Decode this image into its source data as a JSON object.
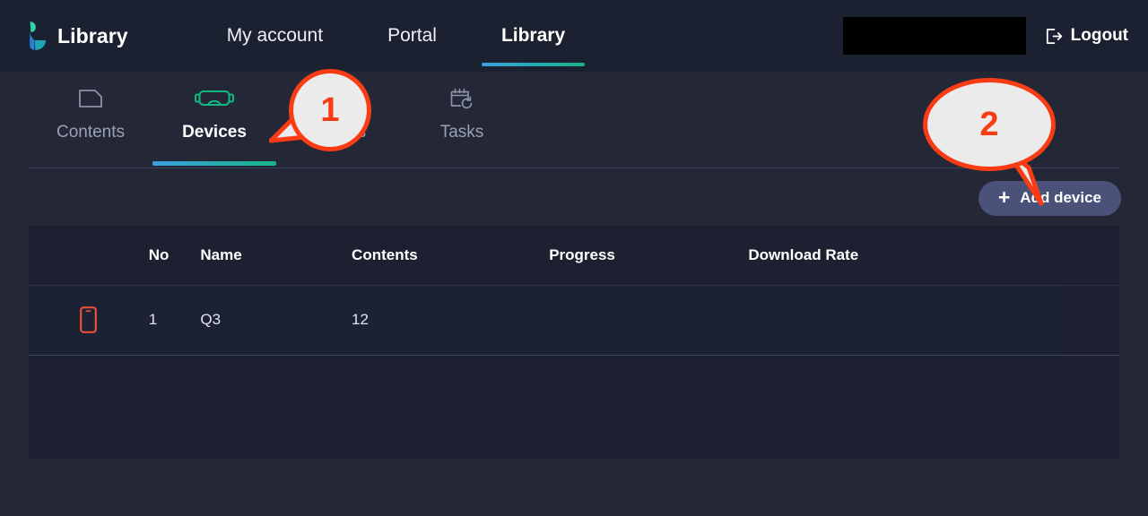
{
  "brand": {
    "name": "Library",
    "logo_icon": "library-logo-icon",
    "logo_color_top": "#2fd3a5",
    "logo_color_bottom": "#2b7fd4"
  },
  "topnav": {
    "items": [
      {
        "label": "My account",
        "active": false
      },
      {
        "label": "Portal",
        "active": false
      },
      {
        "label": "Library",
        "active": true
      }
    ],
    "active_underline_colors": [
      "#3b9fe0",
      "#18b488"
    ]
  },
  "topbar_right": {
    "redacted_field": "",
    "logout_label": "Logout",
    "logout_icon": "logout-icon"
  },
  "tabs": [
    {
      "label": "Contents",
      "icon": "folder-icon",
      "active": false
    },
    {
      "label": "Devices",
      "icon": "vr-headset-icon",
      "active": true
    },
    {
      "label": "Groups",
      "icon": "groups-icon",
      "active": false
    },
    {
      "label": "Tasks",
      "icon": "calendar-refresh-icon",
      "active": false
    }
  ],
  "actions": {
    "add_device_label": "Add device",
    "add_device_icon": "plus-icon",
    "add_device_color": "#4a5279"
  },
  "table": {
    "columns": [
      "",
      "No",
      "Name",
      "Contents",
      "Progress",
      "Download Rate"
    ],
    "rows": [
      {
        "device_icon": "mobile-phone-icon",
        "device_icon_color": "#e8503a",
        "no": "1",
        "name": "Q3",
        "contents": "12",
        "progress": "",
        "download_rate": ""
      }
    ]
  },
  "callouts": [
    {
      "number": "1",
      "target": "devices-tab",
      "fill": "#ebebeb",
      "border": "#fa3c14"
    },
    {
      "number": "2",
      "target": "add-device-button",
      "fill": "#ebebeb",
      "border": "#fa3c14"
    }
  ],
  "colors": {
    "page_background": "#232736",
    "header_background": "#1b2130",
    "panel_background": "#1d2030",
    "row_background": "#1c2134",
    "accent_teal": "#10b981",
    "accent_blue": "#3b9fe0",
    "accent_red": "#fa3c14"
  }
}
